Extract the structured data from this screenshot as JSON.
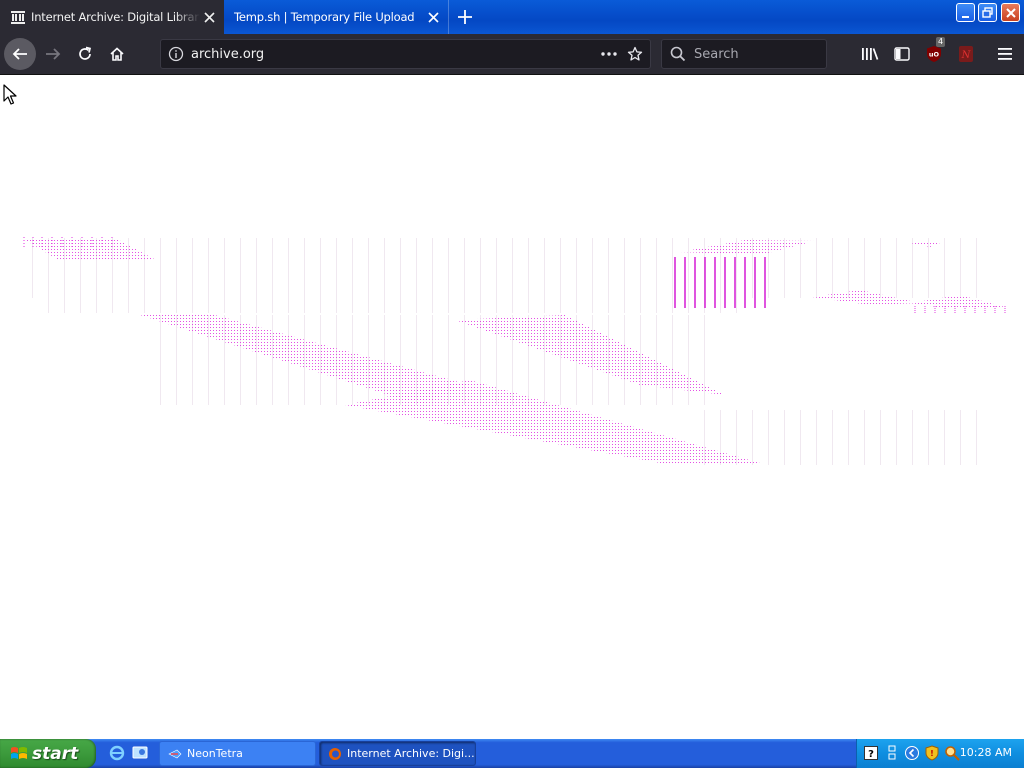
{
  "browser": {
    "tabs": [
      {
        "title": "Internet Archive: Digital Library of",
        "active": true,
        "favicon": "archive-building-icon"
      },
      {
        "title": "Temp.sh | Temporary File Upload",
        "active": false,
        "favicon": "none"
      }
    ],
    "url": "archive.org",
    "search_placeholder": "Search",
    "ublock_badge": "4",
    "colors": {
      "tabstrip": "#0a56d2",
      "toolbar": "#2b2a33",
      "urlbar": "#1c1b22",
      "artifact_magenta": "#e020e0"
    }
  },
  "taskbar": {
    "start_label": "start",
    "tasks": [
      {
        "label": "NeonTetra",
        "icon": "neontetra-icon"
      },
      {
        "label": "Internet Archive: Digi...",
        "icon": "firefox-icon",
        "active": true
      }
    ],
    "clock": "10:28 AM",
    "colors": {
      "bar": "#245edb",
      "start": "#3c9a3c",
      "tray": "#0f8ee0"
    }
  }
}
